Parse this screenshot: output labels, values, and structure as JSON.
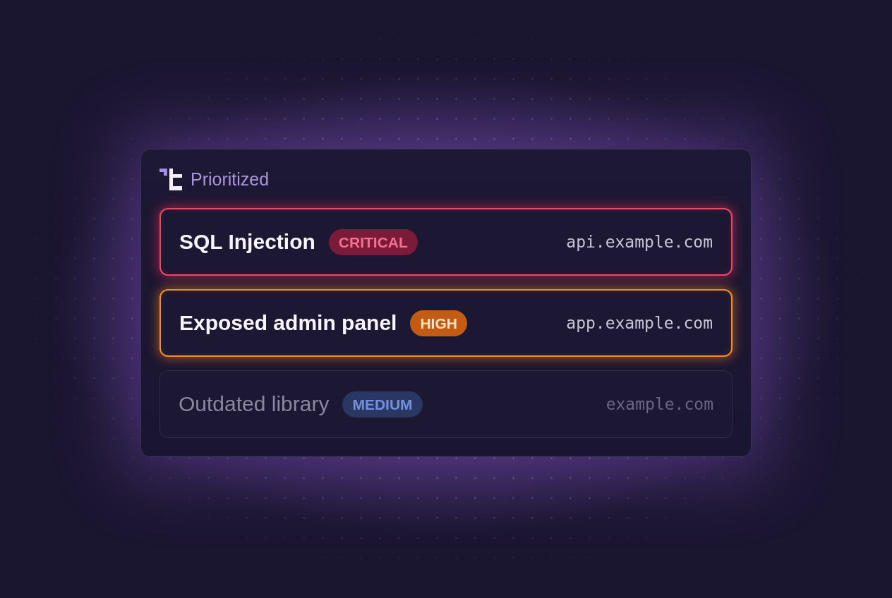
{
  "panel": {
    "title": "Prioritized"
  },
  "findings": [
    {
      "title": "SQL Injection",
      "severity": "CRITICAL",
      "kind": "critical",
      "host": "api.example.com",
      "dimmed": false
    },
    {
      "title": "Exposed admin panel",
      "severity": "HIGH",
      "kind": "high",
      "host": "app.example.com",
      "dimmed": false
    },
    {
      "title": "Outdated library",
      "severity": "MEDIUM",
      "kind": "medium",
      "host": "example.com",
      "dimmed": true
    }
  ]
}
